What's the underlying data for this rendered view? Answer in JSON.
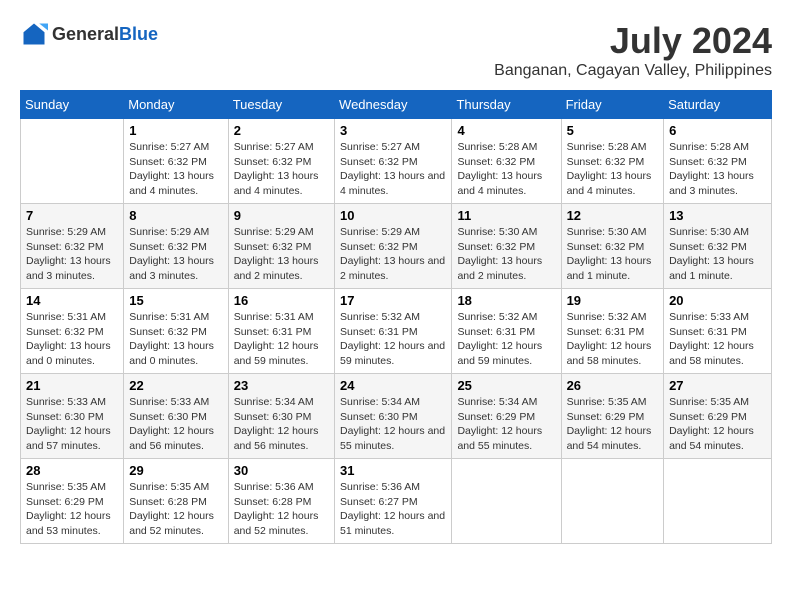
{
  "header": {
    "logo_general": "General",
    "logo_blue": "Blue",
    "month_year": "July 2024",
    "location": "Banganan, Cagayan Valley, Philippines"
  },
  "days_of_week": [
    "Sunday",
    "Monday",
    "Tuesday",
    "Wednesday",
    "Thursday",
    "Friday",
    "Saturday"
  ],
  "weeks": [
    [
      {
        "day": "",
        "sunrise": "",
        "sunset": "",
        "daylight": ""
      },
      {
        "day": "1",
        "sunrise": "Sunrise: 5:27 AM",
        "sunset": "Sunset: 6:32 PM",
        "daylight": "Daylight: 13 hours and 4 minutes."
      },
      {
        "day": "2",
        "sunrise": "Sunrise: 5:27 AM",
        "sunset": "Sunset: 6:32 PM",
        "daylight": "Daylight: 13 hours and 4 minutes."
      },
      {
        "day": "3",
        "sunrise": "Sunrise: 5:27 AM",
        "sunset": "Sunset: 6:32 PM",
        "daylight": "Daylight: 13 hours and 4 minutes."
      },
      {
        "day": "4",
        "sunrise": "Sunrise: 5:28 AM",
        "sunset": "Sunset: 6:32 PM",
        "daylight": "Daylight: 13 hours and 4 minutes."
      },
      {
        "day": "5",
        "sunrise": "Sunrise: 5:28 AM",
        "sunset": "Sunset: 6:32 PM",
        "daylight": "Daylight: 13 hours and 4 minutes."
      },
      {
        "day": "6",
        "sunrise": "Sunrise: 5:28 AM",
        "sunset": "Sunset: 6:32 PM",
        "daylight": "Daylight: 13 hours and 3 minutes."
      }
    ],
    [
      {
        "day": "7",
        "sunrise": "Sunrise: 5:29 AM",
        "sunset": "Sunset: 6:32 PM",
        "daylight": "Daylight: 13 hours and 3 minutes."
      },
      {
        "day": "8",
        "sunrise": "Sunrise: 5:29 AM",
        "sunset": "Sunset: 6:32 PM",
        "daylight": "Daylight: 13 hours and 3 minutes."
      },
      {
        "day": "9",
        "sunrise": "Sunrise: 5:29 AM",
        "sunset": "Sunset: 6:32 PM",
        "daylight": "Daylight: 13 hours and 2 minutes."
      },
      {
        "day": "10",
        "sunrise": "Sunrise: 5:29 AM",
        "sunset": "Sunset: 6:32 PM",
        "daylight": "Daylight: 13 hours and 2 minutes."
      },
      {
        "day": "11",
        "sunrise": "Sunrise: 5:30 AM",
        "sunset": "Sunset: 6:32 PM",
        "daylight": "Daylight: 13 hours and 2 minutes."
      },
      {
        "day": "12",
        "sunrise": "Sunrise: 5:30 AM",
        "sunset": "Sunset: 6:32 PM",
        "daylight": "Daylight: 13 hours and 1 minute."
      },
      {
        "day": "13",
        "sunrise": "Sunrise: 5:30 AM",
        "sunset": "Sunset: 6:32 PM",
        "daylight": "Daylight: 13 hours and 1 minute."
      }
    ],
    [
      {
        "day": "14",
        "sunrise": "Sunrise: 5:31 AM",
        "sunset": "Sunset: 6:32 PM",
        "daylight": "Daylight: 13 hours and 0 minutes."
      },
      {
        "day": "15",
        "sunrise": "Sunrise: 5:31 AM",
        "sunset": "Sunset: 6:32 PM",
        "daylight": "Daylight: 13 hours and 0 minutes."
      },
      {
        "day": "16",
        "sunrise": "Sunrise: 5:31 AM",
        "sunset": "Sunset: 6:31 PM",
        "daylight": "Daylight: 12 hours and 59 minutes."
      },
      {
        "day": "17",
        "sunrise": "Sunrise: 5:32 AM",
        "sunset": "Sunset: 6:31 PM",
        "daylight": "Daylight: 12 hours and 59 minutes."
      },
      {
        "day": "18",
        "sunrise": "Sunrise: 5:32 AM",
        "sunset": "Sunset: 6:31 PM",
        "daylight": "Daylight: 12 hours and 59 minutes."
      },
      {
        "day": "19",
        "sunrise": "Sunrise: 5:32 AM",
        "sunset": "Sunset: 6:31 PM",
        "daylight": "Daylight: 12 hours and 58 minutes."
      },
      {
        "day": "20",
        "sunrise": "Sunrise: 5:33 AM",
        "sunset": "Sunset: 6:31 PM",
        "daylight": "Daylight: 12 hours and 58 minutes."
      }
    ],
    [
      {
        "day": "21",
        "sunrise": "Sunrise: 5:33 AM",
        "sunset": "Sunset: 6:30 PM",
        "daylight": "Daylight: 12 hours and 57 minutes."
      },
      {
        "day": "22",
        "sunrise": "Sunrise: 5:33 AM",
        "sunset": "Sunset: 6:30 PM",
        "daylight": "Daylight: 12 hours and 56 minutes."
      },
      {
        "day": "23",
        "sunrise": "Sunrise: 5:34 AM",
        "sunset": "Sunset: 6:30 PM",
        "daylight": "Daylight: 12 hours and 56 minutes."
      },
      {
        "day": "24",
        "sunrise": "Sunrise: 5:34 AM",
        "sunset": "Sunset: 6:30 PM",
        "daylight": "Daylight: 12 hours and 55 minutes."
      },
      {
        "day": "25",
        "sunrise": "Sunrise: 5:34 AM",
        "sunset": "Sunset: 6:29 PM",
        "daylight": "Daylight: 12 hours and 55 minutes."
      },
      {
        "day": "26",
        "sunrise": "Sunrise: 5:35 AM",
        "sunset": "Sunset: 6:29 PM",
        "daylight": "Daylight: 12 hours and 54 minutes."
      },
      {
        "day": "27",
        "sunrise": "Sunrise: 5:35 AM",
        "sunset": "Sunset: 6:29 PM",
        "daylight": "Daylight: 12 hours and 54 minutes."
      }
    ],
    [
      {
        "day": "28",
        "sunrise": "Sunrise: 5:35 AM",
        "sunset": "Sunset: 6:29 PM",
        "daylight": "Daylight: 12 hours and 53 minutes."
      },
      {
        "day": "29",
        "sunrise": "Sunrise: 5:35 AM",
        "sunset": "Sunset: 6:28 PM",
        "daylight": "Daylight: 12 hours and 52 minutes."
      },
      {
        "day": "30",
        "sunrise": "Sunrise: 5:36 AM",
        "sunset": "Sunset: 6:28 PM",
        "daylight": "Daylight: 12 hours and 52 minutes."
      },
      {
        "day": "31",
        "sunrise": "Sunrise: 5:36 AM",
        "sunset": "Sunset: 6:27 PM",
        "daylight": "Daylight: 12 hours and 51 minutes."
      },
      {
        "day": "",
        "sunrise": "",
        "sunset": "",
        "daylight": ""
      },
      {
        "day": "",
        "sunrise": "",
        "sunset": "",
        "daylight": ""
      },
      {
        "day": "",
        "sunrise": "",
        "sunset": "",
        "daylight": ""
      }
    ]
  ]
}
